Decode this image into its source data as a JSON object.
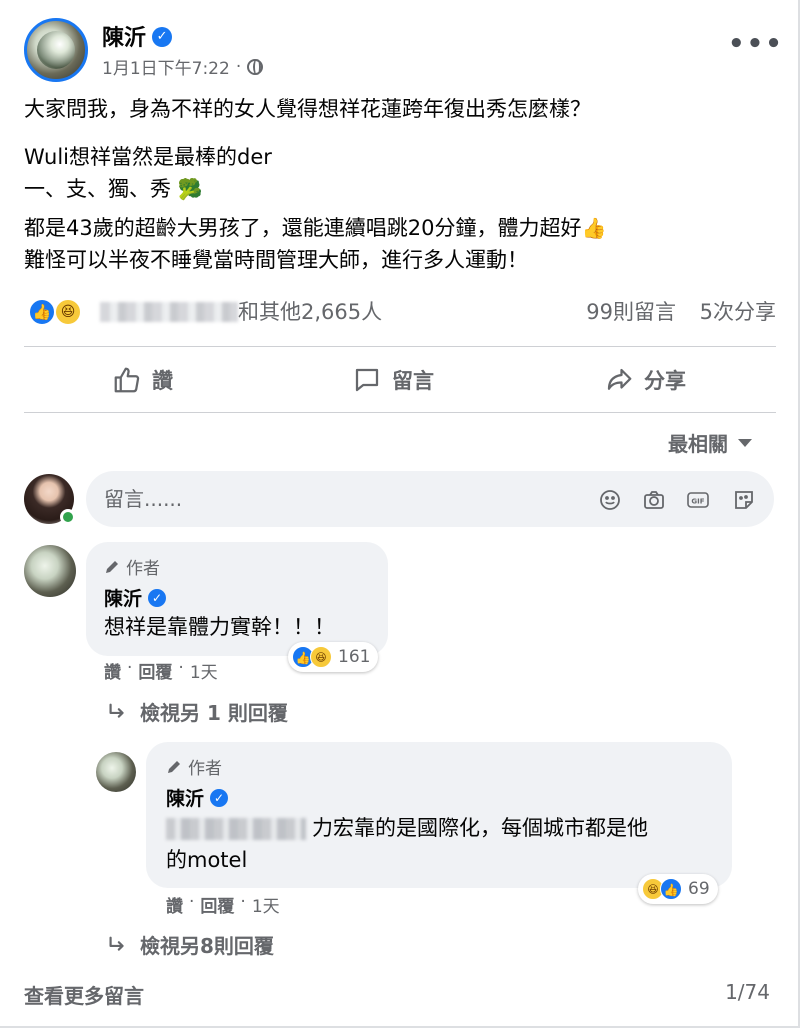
{
  "post": {
    "author": "陳沂",
    "time": "1月1日下午7:22",
    "separator": "·",
    "paragraphs": [
      "大家問我，身為不祥的女人覺得想祥花蓮跨年復出秀怎麼樣？",
      "Wuli想祥當然是最棒的der",
      "一、支、獨、秀",
      "都是43歲的超齡大男孩了，還能連續唱跳20分鐘，體力超好",
      "難怪可以半夜不睡覺當時間管理大師，進行多人運動！"
    ],
    "emoji_broccoli": "🥦",
    "emoji_thumb": "👍"
  },
  "reactions": {
    "summary_suffix": "和其他2,665人",
    "comments": "99則留言",
    "shares": "5次分享"
  },
  "actions": {
    "like": "讚",
    "comment": "留言",
    "share": "分享"
  },
  "sort_label": "最相關",
  "composer": {
    "placeholder": "留言......"
  },
  "comments": [
    {
      "tag": "作者",
      "name": "陳沂",
      "text": "想祥是靠體力實幹！！！",
      "reaction_count": "161",
      "like_label": "讚",
      "dot": "·",
      "reply_label": "回覆",
      "time": "1天",
      "view_replies": "檢視另 1 則回覆"
    },
    {
      "tag": "作者",
      "name": "陳沂",
      "text_line1": "力宏靠的是國際化，每個城市都是他",
      "text_line2": "的motel",
      "reaction_count": "69",
      "like_label": "讚",
      "dot": "·",
      "reply_label": "回覆",
      "time": "1天",
      "view_replies": "檢視另8則回覆"
    }
  ],
  "footer": {
    "more": "查看更多留言",
    "page": "1/74"
  },
  "colors": {
    "brand_blue": "#1877f2",
    "secondary_text": "#65676b",
    "bubble_bg": "#f0f2f5",
    "haha_yellow": "#f7c93a"
  }
}
